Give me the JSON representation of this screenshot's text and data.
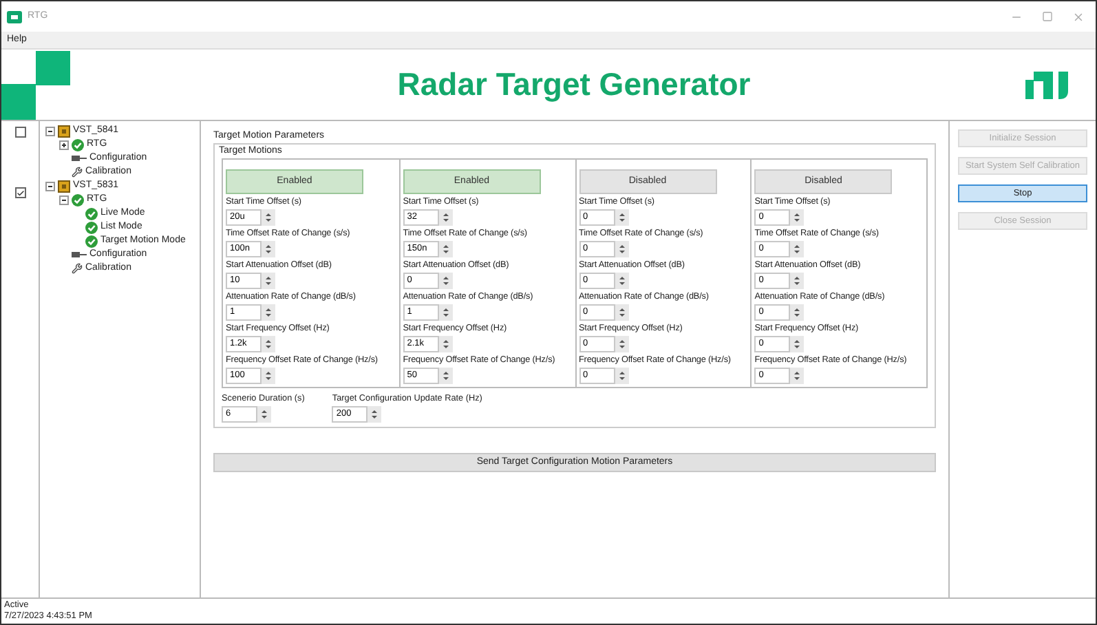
{
  "window": {
    "title": "RTG"
  },
  "menu": [
    "Help"
  ],
  "header": {
    "title": "Radar Target Generator"
  },
  "tree": [
    {
      "label": "VST_5841",
      "kind": "device",
      "checked": false,
      "expanded": true,
      "children": [
        {
          "label": "RTG",
          "kind": "rtg",
          "expanded": false
        },
        {
          "label": "Configuration",
          "kind": "config"
        },
        {
          "label": "Calibration",
          "kind": "calibration"
        }
      ]
    },
    {
      "label": "VST_5831",
      "kind": "device",
      "checked": true,
      "expanded": true,
      "children": [
        {
          "label": "RTG",
          "kind": "rtg",
          "expanded": true,
          "children": [
            {
              "label": "Live Mode",
              "kind": "mode"
            },
            {
              "label": "List Mode",
              "kind": "mode"
            },
            {
              "label": "Target Motion Mode",
              "kind": "mode"
            }
          ]
        },
        {
          "label": "Configuration",
          "kind": "config"
        },
        {
          "label": "Calibration",
          "kind": "calibration"
        }
      ]
    }
  ],
  "panel": {
    "title": "Target Motion Parameters",
    "group_title": "Target Motions",
    "motions": [
      {
        "state": "Enabled",
        "enabled": true,
        "fields": [
          {
            "label": "Start Time Offset (s)",
            "value": "20u"
          },
          {
            "label": "Time Offset Rate of Change (s/s)",
            "value": "100n"
          },
          {
            "label": "Start Attenuation Offset (dB)",
            "value": "10"
          },
          {
            "label": "Attenuation Rate of Change (dB/s)",
            "value": "1"
          },
          {
            "label": "Start Frequency Offset (Hz)",
            "value": "1.2k"
          },
          {
            "label": "Frequency Offset Rate of Change (Hz/s)",
            "value": "100"
          }
        ]
      },
      {
        "state": "Enabled",
        "enabled": true,
        "fields": [
          {
            "label": "Start Time Offset (s)",
            "value": "32"
          },
          {
            "label": "Time Offset Rate of Change (s/s)",
            "value": "150n"
          },
          {
            "label": "Start Attenuation Offset (dB)",
            "value": "0"
          },
          {
            "label": "Attenuation Rate of Change (dB/s)",
            "value": "1"
          },
          {
            "label": "Start Frequency Offset (Hz)",
            "value": "2.1k"
          },
          {
            "label": "Frequency Offset Rate of Change (Hz/s)",
            "value": "50"
          }
        ]
      },
      {
        "state": "Disabled",
        "enabled": false,
        "fields": [
          {
            "label": "Start Time Offset (s)",
            "value": "0"
          },
          {
            "label": "Time Offset Rate of Change (s/s)",
            "value": "0"
          },
          {
            "label": "Start Attenuation Offset (dB)",
            "value": "0"
          },
          {
            "label": "Attenuation Rate of Change (dB/s)",
            "value": "0"
          },
          {
            "label": "Start Frequency Offset (Hz)",
            "value": "0"
          },
          {
            "label": "Frequency Offset Rate of Change (Hz/s)",
            "value": "0"
          }
        ]
      },
      {
        "state": "Disabled",
        "enabled": false,
        "fields": [
          {
            "label": "Start Time Offset (s)",
            "value": "0"
          },
          {
            "label": "Time Offset Rate of Change (s/s)",
            "value": "0"
          },
          {
            "label": "Start Attenuation Offset (dB)",
            "value": "0"
          },
          {
            "label": "Attenuation Rate of Change (dB/s)",
            "value": "0"
          },
          {
            "label": "Start Frequency Offset (Hz)",
            "value": "0"
          },
          {
            "label": "Frequency Offset Rate of Change (Hz/s)",
            "value": "0"
          }
        ]
      }
    ],
    "settings": [
      {
        "label": "Scenerio Duration (s)",
        "value": "6"
      },
      {
        "label": "Target Configuration Update Rate (Hz)",
        "value": "200"
      }
    ],
    "send_button": "Send Target Configuration Motion Parameters"
  },
  "actions": [
    {
      "label": "Initialize Session",
      "disabled": true,
      "selected": false
    },
    {
      "label": "Start System Self Calibration",
      "disabled": true,
      "selected": false
    },
    {
      "label": "Stop",
      "disabled": false,
      "selected": true
    },
    {
      "label": "Close Session",
      "disabled": true,
      "selected": false
    }
  ],
  "status_bar": {
    "state": "Active",
    "time": "7/27/2023 4:43:51 PM"
  }
}
